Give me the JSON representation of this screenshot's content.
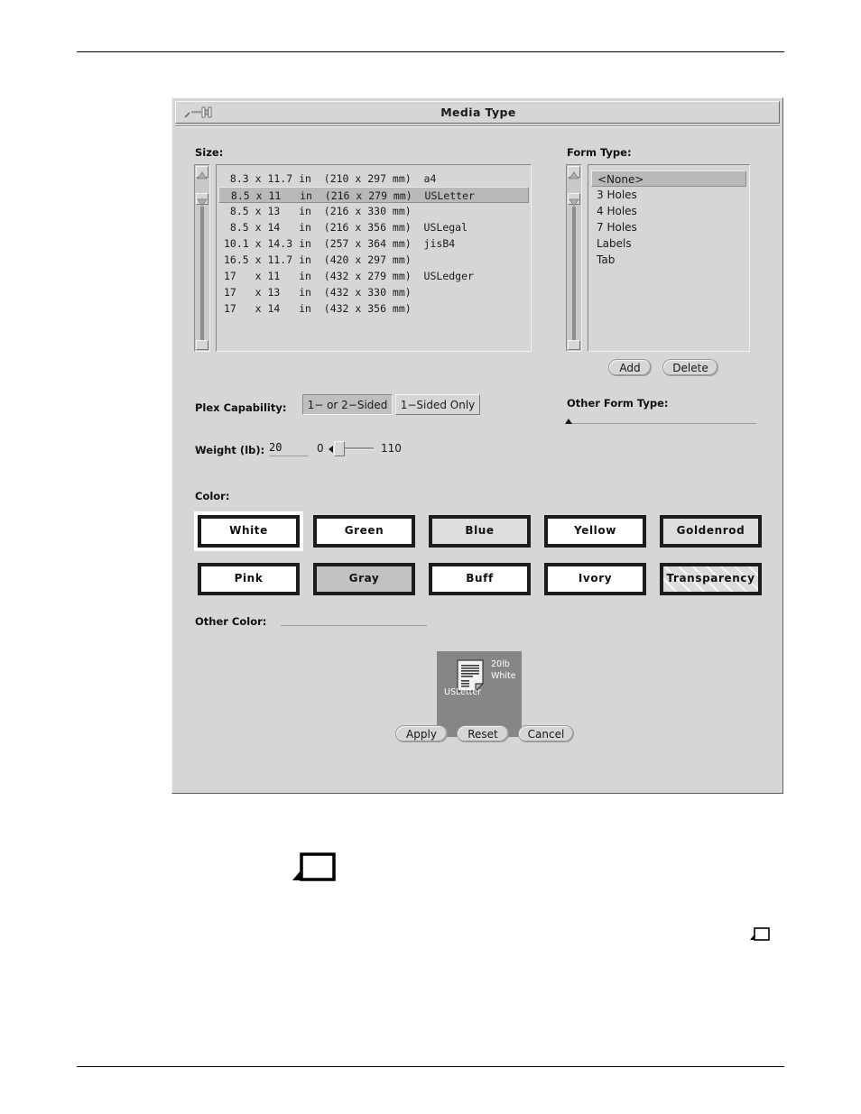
{
  "window": {
    "title": "Media Type",
    "menu_icon": "window-menu-icon"
  },
  "size_section": {
    "label": "Size:",
    "selected_index": 1,
    "items": [
      " 8.3 x 11.7 in  (210 x 297 mm)  a4",
      " 8.5 x 11   in  (216 x 279 mm)  USLetter",
      " 8.5 x 13   in  (216 x 330 mm)",
      " 8.5 x 14   in  (216 x 356 mm)  USLegal",
      "10.1 x 14.3 in  (257 x 364 mm)  jisB4",
      "16.5 x 11.7 in  (420 x 297 mm)",
      "17   x 11   in  (432 x 279 mm)  USLedger",
      "17   x 13   in  (432 x 330 mm)",
      "17   x 14   in  (432 x 356 mm)"
    ]
  },
  "form_type_section": {
    "label": "Form Type:",
    "selected_index": 0,
    "items": [
      "<None>",
      "3 Holes",
      "4 Holes",
      "7 Holes",
      "Labels",
      "Tab"
    ],
    "add_label": "Add",
    "delete_label": "Delete"
  },
  "other_form_type": {
    "label": "Other Form Type:",
    "value": ""
  },
  "plex": {
    "label": "Plex Capability:",
    "options": [
      "1− or 2−Sided",
      "1−Sided Only"
    ],
    "selected_index": 0
  },
  "weight": {
    "label": "Weight (lb):",
    "value": "20",
    "min": "0",
    "max": "110"
  },
  "color_section": {
    "label": "Color:",
    "selected": "White",
    "swatches": [
      {
        "label": "White",
        "fill": "#ffffff",
        "pattern": "none"
      },
      {
        "label": "Green",
        "fill": "#ffffff",
        "pattern": "none"
      },
      {
        "label": "Blue",
        "fill": "#dedede",
        "pattern": "none"
      },
      {
        "label": "Yellow",
        "fill": "#ffffff",
        "pattern": "none"
      },
      {
        "label": "Goldenrod",
        "fill": "#dedede",
        "pattern": "none"
      },
      {
        "label": "Pink",
        "fill": "#ffffff",
        "pattern": "none"
      },
      {
        "label": "Gray",
        "fill": "#c2c2c2",
        "pattern": "none"
      },
      {
        "label": "Buff",
        "fill": "#ffffff",
        "pattern": "none"
      },
      {
        "label": "Ivory",
        "fill": "#ffffff",
        "pattern": "none"
      },
      {
        "label": "Transparency",
        "fill": "#dcdcdc",
        "pattern": "hatch"
      }
    ]
  },
  "other_color": {
    "label": "Other Color:",
    "value": ""
  },
  "preview": {
    "weight_text": "20lb",
    "color_text": "White",
    "size_text": "USLetter",
    "background": "#868686",
    "icon": "document-icon"
  },
  "actions": {
    "apply": "Apply",
    "reset": "Reset",
    "cancel": "Cancel"
  },
  "page_marks": {
    "mark_large": "page-corner-icon",
    "mark_small": "page-corner-icon"
  }
}
